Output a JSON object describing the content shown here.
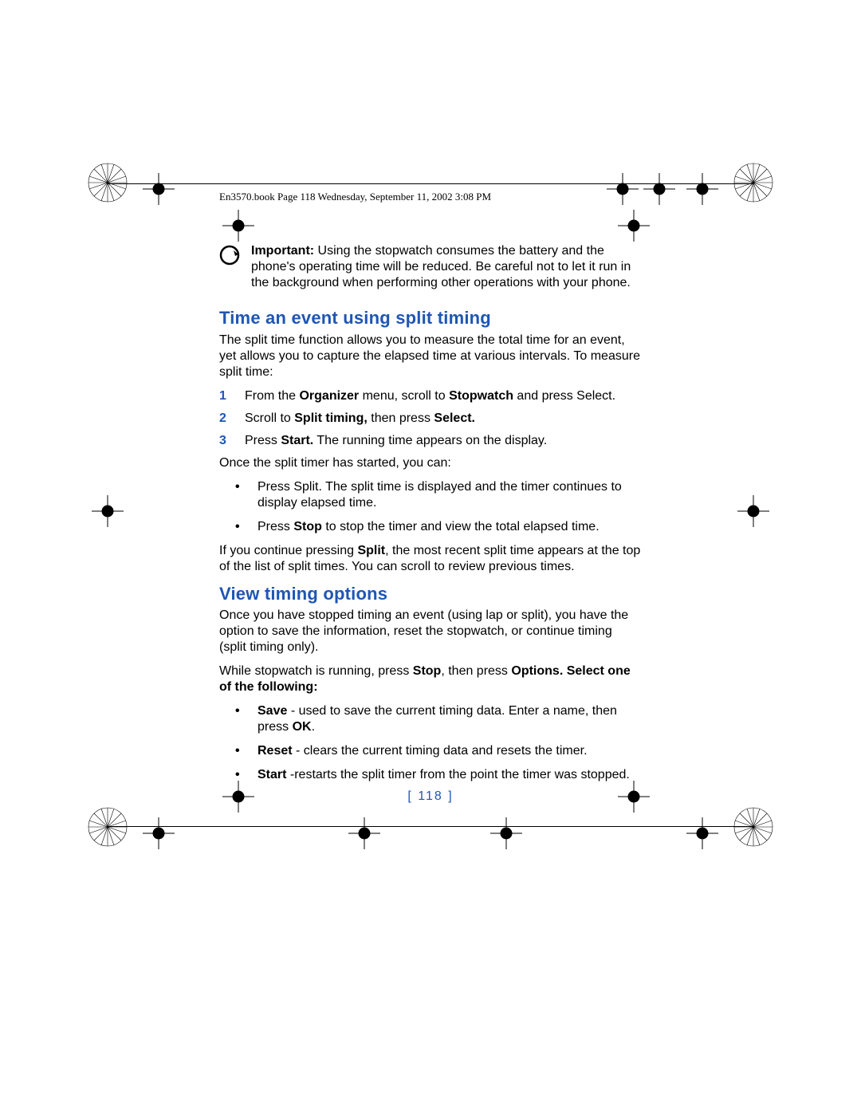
{
  "header": "En3570.book  Page 118  Wednesday, September 11, 2002  3:08 PM",
  "important_label": "Important:",
  "important_text": " Using the stopwatch consumes the battery and the phone's operating time will be reduced. Be careful not to let it run in the background when performing other operations with your phone.",
  "h1": "Time an event using split timing",
  "p1": "The split time function allows you to measure the total time for an event, yet allows you to capture the elapsed time at various intervals. To measure split time:",
  "step1_a": "From the ",
  "step1_b": "Organizer",
  "step1_c": " menu, scroll to ",
  "step1_d": "Stopwatch",
  "step1_e": " and press Select.",
  "step2_a": "Scroll to ",
  "step2_b": "Split timing,",
  "step2_c": " then press ",
  "step2_d": "Select.",
  "step3_a": "Press ",
  "step3_b": "Start.",
  "step3_c": " The running time appears on the display.",
  "p2": "Once the split timer has started, you can:",
  "b1": "Press Split. The split time is displayed and the timer continues to display elapsed time.",
  "b2_a": "Press ",
  "b2_b": "Stop",
  "b2_c": " to stop the timer and view the total elapsed time.",
  "p3_a": "If you continue pressing ",
  "p3_b": "Split",
  "p3_c": ", the most recent split time appears at the top of the list of split times. You can scroll to review previous times.",
  "h2": "View timing options",
  "p4": "Once you have stopped timing an event (using lap or split), you have the option to save the information, reset the stopwatch, or continue timing (split timing only).",
  "p5_a": "While stopwatch is running, press ",
  "p5_b": "Stop",
  "p5_c": ", then press ",
  "p5_d": "Options. Select one of the following:",
  "opt1_a": "Save",
  "opt1_b": " - used to save the current timing data. Enter a name, then press ",
  "opt1_c": "OK",
  "opt1_d": ".",
  "opt2_a": "Reset",
  "opt2_b": " - clears the current timing data and resets the timer.",
  "opt3_a": "Start",
  "opt3_b": " -restarts the split timer from the point the timer was stopped.",
  "page_number": "[ 118 ]",
  "num1": "1",
  "num2": "2",
  "num3": "3",
  "dot": "•"
}
